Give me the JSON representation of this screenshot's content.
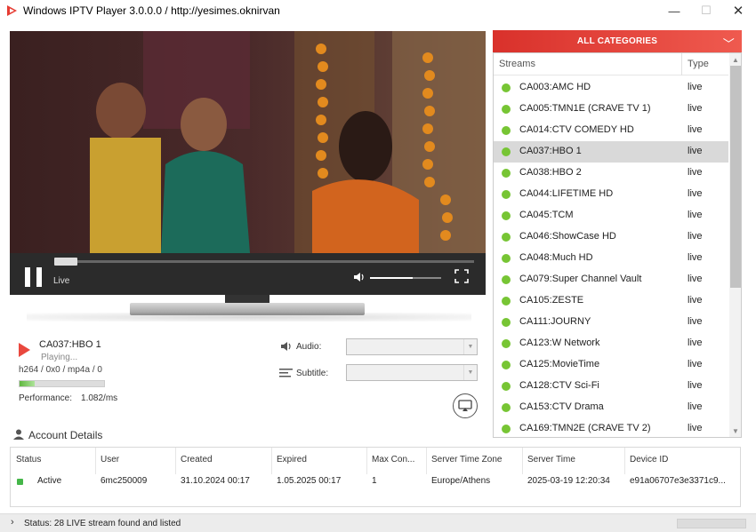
{
  "window": {
    "title": "Windows IPTV Player 3.0.0.0 / http://yesimes.oknirvan",
    "minimize": "—",
    "maximize": "☐",
    "close": "✕"
  },
  "player": {
    "live_label": "Live",
    "progress_fraction": 0.05,
    "volume_fraction": 0.6
  },
  "now_playing": {
    "title": "CA037:HBO 1",
    "status": "Playing...",
    "codec": "h264 / 0x0 / mp4a / 0",
    "buffer_fraction": 0.18,
    "performance_label": "Performance:",
    "performance_value": "1.082/ms"
  },
  "tracks": {
    "audio_label": "Audio:",
    "subtitle_label": "Subtitle:",
    "audio_value": "",
    "subtitle_value": ""
  },
  "categories": {
    "header": "ALL CATEGORIES",
    "col_streams": "Streams",
    "col_type": "Type",
    "streams": [
      {
        "name": "CA003:AMC HD",
        "type": "live"
      },
      {
        "name": "CA005:TMN1E (CRAVE TV 1)",
        "type": "live"
      },
      {
        "name": "CA014:CTV COMEDY HD",
        "type": "live"
      },
      {
        "name": "CA037:HBO 1",
        "type": "live",
        "selected": true
      },
      {
        "name": "CA038:HBO 2",
        "type": "live"
      },
      {
        "name": "CA044:LIFETIME HD",
        "type": "live"
      },
      {
        "name": "CA045:TCM",
        "type": "live"
      },
      {
        "name": "CA046:ShowCase HD",
        "type": "live"
      },
      {
        "name": "CA048:Much HD",
        "type": "live"
      },
      {
        "name": "CA079:Super Channel Vault",
        "type": "live"
      },
      {
        "name": "CA105:ZESTE",
        "type": "live"
      },
      {
        "name": "CA111:JOURNY",
        "type": "live"
      },
      {
        "name": "CA123:W Network",
        "type": "live"
      },
      {
        "name": "CA125:MovieTime",
        "type": "live"
      },
      {
        "name": "CA128:CTV Sci-Fi",
        "type": "live"
      },
      {
        "name": "CA153:CTV Drama",
        "type": "live"
      },
      {
        "name": "CA169:TMN2E (CRAVE TV 2)",
        "type": "live"
      }
    ]
  },
  "account": {
    "title": "Account Details",
    "headers": [
      "Status",
      "User",
      "Created",
      "Expired",
      "Max Con...",
      "Server Time Zone",
      "Server Time",
      "Device ID"
    ],
    "values": [
      "Active",
      "6mc250009",
      "31.10.2024 00:17",
      "1.05.2025 00:17",
      "1",
      "Europe/Athens",
      "2025-03-19 12:20:34",
      "e91a06707e3e3371c9..."
    ]
  },
  "statusbar": {
    "text": "Status: 28 LIVE stream found and listed"
  },
  "colors": {
    "accent": "#e63c33",
    "live_dot": "#77c534",
    "active_dot": "#45b649"
  },
  "icons": [
    "app-logo-icon",
    "pause-icon",
    "volume-icon",
    "fullscreen-icon",
    "play-icon",
    "audio-icon",
    "subtitle-icon",
    "cast-icon",
    "chevron-down-icon",
    "user-icon",
    "chevron-right-icon"
  ]
}
